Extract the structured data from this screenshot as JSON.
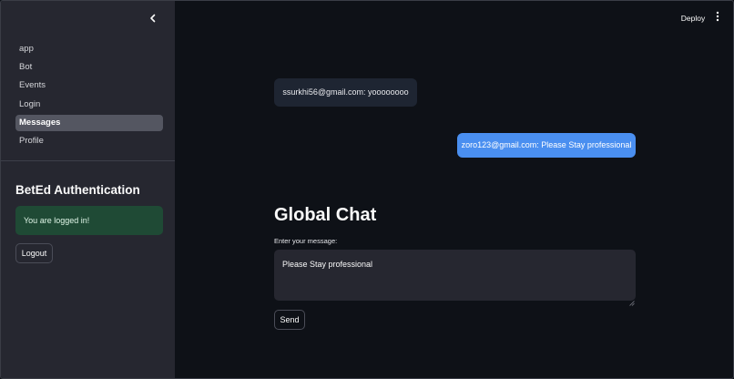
{
  "header": {
    "deploy_label": "Deploy"
  },
  "sidebar": {
    "collapse_icon": "chevron-left-icon",
    "nav_items": [
      {
        "label": "app"
      },
      {
        "label": "Bot"
      },
      {
        "label": "Events"
      },
      {
        "label": "Login"
      },
      {
        "label": "Messages",
        "active": true
      },
      {
        "label": "Profile"
      }
    ],
    "auth_title": "BetEd Authentication",
    "status_message": "You are logged in!",
    "logout_label": "Logout"
  },
  "chat": {
    "messages": [
      {
        "text": "ssurkhi56@gmail.com: yoooooooo",
        "side": "left"
      },
      {
        "text": "zoro123@gmail.com: Please Stay professional",
        "side": "right"
      }
    ],
    "title": "Global Chat",
    "input_label": "Enter your message:",
    "input_value": "Please Stay professional",
    "send_label": "Send"
  },
  "colors": {
    "background": "#0e1117",
    "sidebar": "#262730",
    "accent": "#4a8ff0",
    "success_bg": "#1f4a35"
  }
}
